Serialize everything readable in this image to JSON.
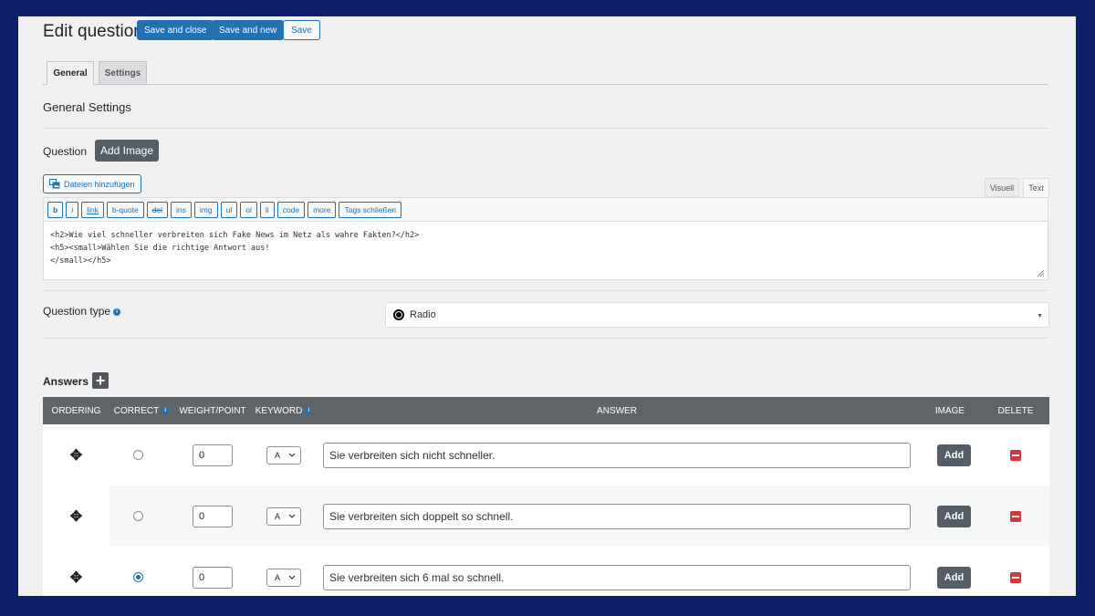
{
  "header": {
    "title": "Edit question",
    "save_close_label": "Save and close",
    "save_new_label": "Save and new",
    "save_label": "Save"
  },
  "tabs": [
    {
      "label": "General",
      "active": true
    },
    {
      "label": "Settings",
      "active": false
    }
  ],
  "general_settings_title": "General Settings",
  "question": {
    "label": "Question",
    "add_image_label": "Add Image",
    "media_button_label": "Dateien hinzufügen",
    "editor_tabs": [
      "Visuell",
      "Text"
    ],
    "active_editor_tab": "Text",
    "quicktags": [
      "b",
      "i",
      "link",
      "b-quote",
      "del",
      "ins",
      "img",
      "ul",
      "ol",
      "li",
      "code",
      "more",
      "Tags schließen"
    ],
    "content_lines": [
      "<h2>Wie viel schneller verbreiten sich Fake News im Netz als wahre Fakten?</h2>",
      "<h5><small>Wählen Sie die richtige Antwort aus!",
      "</small></h5>"
    ]
  },
  "question_type": {
    "label": "Question type",
    "value": "Radio"
  },
  "answers": {
    "label": "Answers",
    "columns": [
      "ORDERING",
      "CORRECT",
      "WEIGHT/POINT",
      "KEYWORD",
      "ANSWER",
      "IMAGE",
      "DELETE"
    ],
    "rows": [
      {
        "correct": false,
        "weight": "0",
        "keyword": "A",
        "answer": "Sie verbreiten sich nicht schneller.",
        "image_button": "Add"
      },
      {
        "correct": false,
        "weight": "0",
        "keyword": "A",
        "answer": "Sie verbreiten sich doppelt so schnell.",
        "image_button": "Add"
      },
      {
        "correct": true,
        "weight": "0",
        "keyword": "A",
        "answer": "Sie verbreiten sich 6 mal so schnell.",
        "image_button": "Add"
      }
    ]
  },
  "colors": {
    "background": "#0b1f6b",
    "primary": "#2271b1",
    "table_header": "#5f6468",
    "delete": "#d63638"
  }
}
